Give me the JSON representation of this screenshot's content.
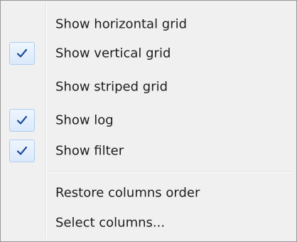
{
  "menu": {
    "items": [
      {
        "label": "Show horizontal grid",
        "checked": false
      },
      {
        "label": "Show vertical grid",
        "checked": true
      },
      {
        "label": "Show striped grid",
        "checked": false
      },
      {
        "label": "Show log",
        "checked": true
      },
      {
        "label": "Show filter",
        "checked": true
      }
    ],
    "actions": [
      {
        "label": "Restore columns order"
      },
      {
        "label": "Select columns..."
      }
    ]
  },
  "colors": {
    "menu_background": "#f0f0f0",
    "menu_border": "#979797",
    "check_highlight_border": "#aeccef",
    "check_mark": "#1c4a9c",
    "text": "#1e1e1e"
  },
  "icons": {
    "check": "checkmark-icon"
  }
}
